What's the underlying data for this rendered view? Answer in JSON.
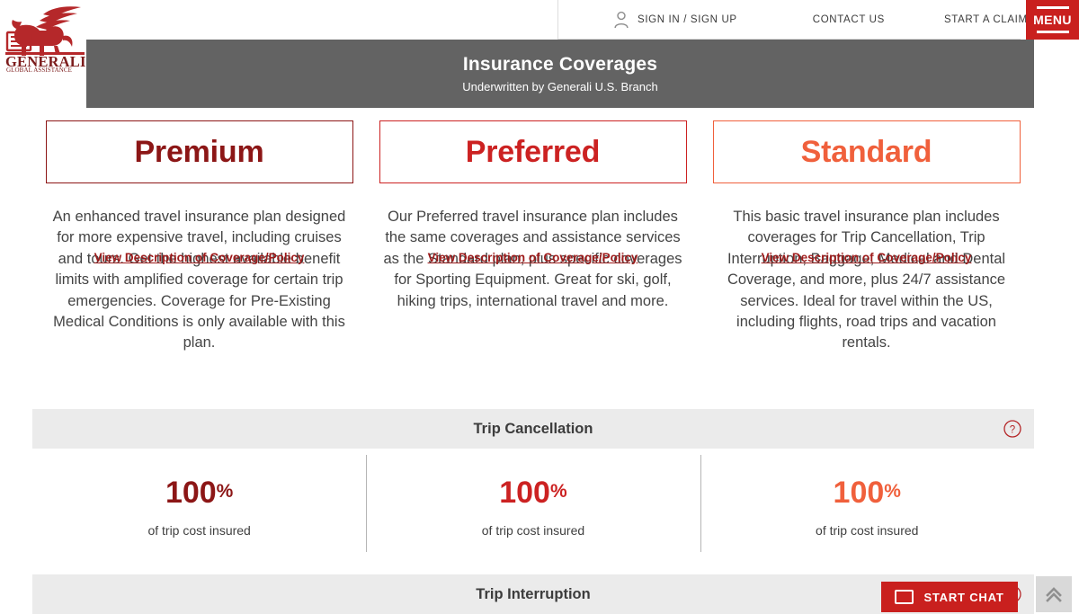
{
  "topnav": {
    "user_icon": "user-icon",
    "signin_label": "SIGN IN / SIGN UP",
    "contact_label": "CONTACT US",
    "claim_label": "START A CLAIM",
    "menu_label": "MENU"
  },
  "brand": {
    "logo_name": "GENERALI",
    "logo_tagline": "GLOBAL ASSISTANCE"
  },
  "header": {
    "title": "Insurance Coverages",
    "subtitle": "Underwritten by Generali U.S. Branch"
  },
  "colors": {
    "premium": "#8c1616",
    "preferred": "#cc2222",
    "standard": "#f0603c",
    "brand_red": "#c9201e",
    "header_gray": "#636363",
    "section_gray": "#ebebeb"
  },
  "plans": [
    {
      "name": "Premium",
      "color": "#8c1616",
      "description": "An enhanced travel insurance plan designed for more expensive travel, including cruises and tours. Get the highest available benefit limits with amplified coverage for certain trip emergencies. Coverage for Pre-Existing Medical Conditions is only available with this plan.",
      "link_label": "View Description of Coverage/Policy"
    },
    {
      "name": "Preferred",
      "color": "#cc2222",
      "description": "Our Preferred travel insurance plan includes the same coverages and assistance services as the Standard plan, plus specific coverages for Sporting Equipment. Great for ski, golf, hiking trips, international travel and more.",
      "link_label": "View Description of Coverage/Policy"
    },
    {
      "name": "Standard",
      "color": "#f0603c",
      "description": "This basic travel insurance plan includes coverages for Trip Cancellation, Trip Interruption, Baggage, Medical and Dental Coverage, and more, plus 24/7 assistance services. Ideal for travel within the US, including flights, road trips and vacation rentals.",
      "link_label": "View Description of Coverage/Policy"
    }
  ],
  "benefits": [
    {
      "title": "Trip Cancellation",
      "help_icon": "help-circle-icon",
      "cells": [
        {
          "value": "100",
          "unit": "%",
          "sub": "of trip cost insured",
          "color": "#8c1616"
        },
        {
          "value": "100",
          "unit": "%",
          "sub": "of trip cost insured",
          "color": "#cc2222"
        },
        {
          "value": "100",
          "unit": "%",
          "sub": "of trip cost insured",
          "color": "#f0603c"
        }
      ]
    },
    {
      "title": "Trip Interruption",
      "help_icon": "help-circle-icon",
      "cells": []
    }
  ],
  "widgets": {
    "chat_label": "START CHAT",
    "chat_icon": "chat-bubble-icon",
    "scroll_top_icon": "chevron-double-up-icon"
  }
}
